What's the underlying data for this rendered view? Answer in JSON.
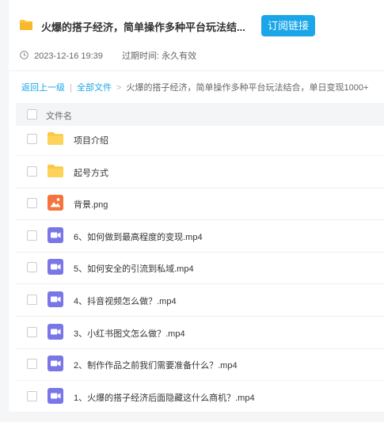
{
  "header": {
    "title": "火爆的搭子经济，简单操作多种平台玩法结...",
    "subscribe_label": "订阅链接"
  },
  "meta": {
    "date": "2023-12-16 19:39",
    "expire_label": "过期时间:",
    "expire_value": "永久有效"
  },
  "breadcrumb": {
    "back": "返回上一级",
    "sep1": "|",
    "all_files": "全部文件",
    "sep2": ">",
    "current": "火爆的搭子经济，简单操作多种平台玩法结合，单日变现1000+"
  },
  "table": {
    "column_label": "文件名",
    "rows": [
      {
        "name": "项目介绍",
        "type": "folder"
      },
      {
        "name": "起号方式",
        "type": "folder"
      },
      {
        "name": "背景.png",
        "type": "image"
      },
      {
        "name": "6、如何做到最高程度的变现.mp4",
        "type": "video"
      },
      {
        "name": "5、如何安全的引流到私域.mp4",
        "type": "video"
      },
      {
        "name": "4、抖音视频怎么做？.mp4",
        "type": "video"
      },
      {
        "name": "3、小红书图文怎么做？.mp4",
        "type": "video"
      },
      {
        "name": "2、制作作品之前我们需要准备什么？.mp4",
        "type": "video"
      },
      {
        "name": "1、火爆的搭子经济后面隐藏这什么商机？.mp4",
        "type": "video"
      }
    ]
  },
  "colors": {
    "accent": "#1aa6e8",
    "folder": "#fcc73f",
    "image_icon": "#f5733d",
    "video_icon": "#7b76e8"
  }
}
